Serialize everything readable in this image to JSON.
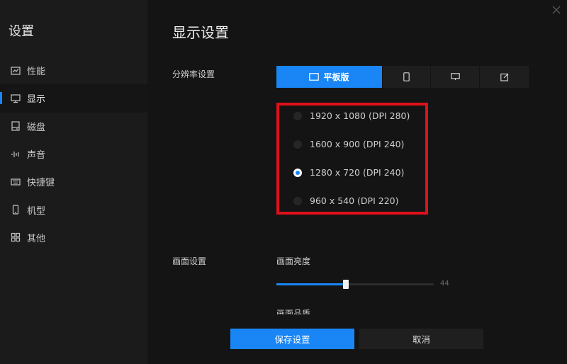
{
  "sidebar": {
    "title": "设置",
    "items": [
      {
        "label": "性能",
        "icon": "chart-line-icon"
      },
      {
        "label": "显示",
        "icon": "monitor-icon",
        "active": true
      },
      {
        "label": "磁盘",
        "icon": "disk-icon"
      },
      {
        "label": "声音",
        "icon": "sound-wave-icon"
      },
      {
        "label": "快捷键",
        "icon": "keyboard-icon"
      },
      {
        "label": "机型",
        "icon": "phone-icon"
      },
      {
        "label": "其他",
        "icon": "grid-icon"
      }
    ]
  },
  "main": {
    "title": "显示设置",
    "resolution_label": "分辨率设置",
    "tabs": [
      {
        "label": "平板版",
        "icon": "tablet-icon",
        "active": true
      },
      {
        "label": "",
        "icon": "phone-icon"
      },
      {
        "label": "",
        "icon": "monitor-icon"
      },
      {
        "label": "",
        "icon": "edit-icon"
      }
    ],
    "resolutions": [
      {
        "label": "1920 x 1080 (DPI 280)",
        "checked": false
      },
      {
        "label": "1600 x 900 (DPI 240)",
        "checked": false
      },
      {
        "label": "1280 x 720 (DPI 240)",
        "checked": true
      },
      {
        "label": "960 x 540 (DPI 220)",
        "checked": false
      }
    ],
    "screen_label": "画面设置",
    "brightness": {
      "label": "画面亮度",
      "value": "44",
      "fraction": 0.44
    },
    "next_setting_label": "画面品质"
  },
  "footer": {
    "save_label": "保存设置",
    "cancel_label": "取消"
  },
  "colors": {
    "accent": "#1a86f5",
    "highlight_box": "#e0101a",
    "background": "#141414",
    "sidebar_bg": "#1b1b1b"
  }
}
